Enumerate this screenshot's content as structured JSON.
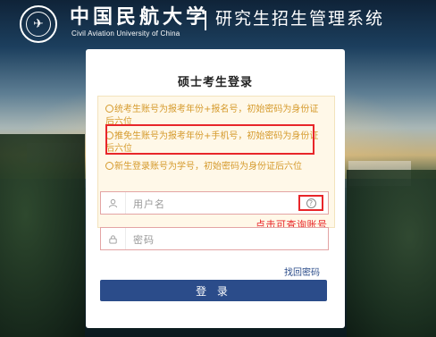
{
  "header": {
    "school_name": "中国民航大学",
    "school_name_en": "Civil Aviation University of China",
    "system_title": "研究生招生管理系统"
  },
  "login": {
    "title": "硕士考生登录",
    "tips": [
      "统考生账号为报考年份+报名号，初始密码为身份证后六位",
      "推免生账号为报考年份+手机号，初始密码为身份证后六位",
      "新生登录账号为学号，初始密码为身份证后六位"
    ],
    "username_placeholder": "用户名",
    "password_placeholder": "密码",
    "help_annotation": "点击可查询账号",
    "forgot_password": "找回密码",
    "login_button": "登 录"
  },
  "colors": {
    "accent": "#2b4c8a",
    "tip_text": "#d59a2c",
    "annotation_red": "#e8262a"
  },
  "icons": {
    "logo": "university-seal-icon",
    "tip": "lightbulb-icon",
    "user": "user-icon",
    "lock": "lock-icon",
    "help": "question-circle-icon"
  }
}
